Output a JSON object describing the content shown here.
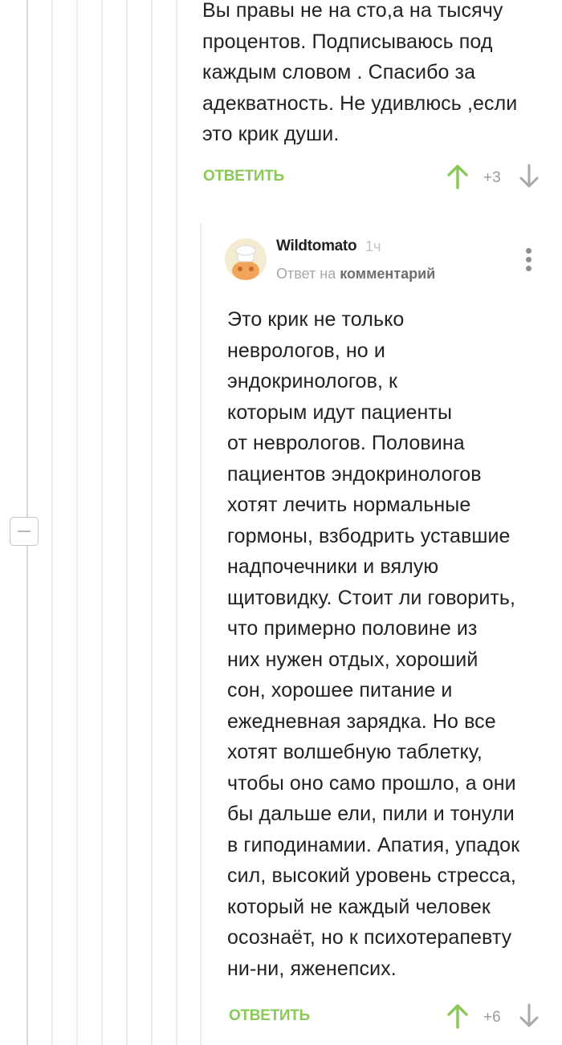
{
  "comment_parent": {
    "text": "Вы правы не на сто,а на тысячу\nпроцентов. Подписываюсь под\nкаждым словом . Спасибо за\nадекватность. Не удивлюсь ,если\nэто крик души.",
    "reply_label": "ОТВЕТИТЬ",
    "score": "+3"
  },
  "comment_reply": {
    "username": "Wildtomato",
    "time": "1ч",
    "reply_to_prefix": "Ответ на",
    "reply_to_link": "комментарий",
    "text": "Это крик не только\nневрологов, но и\nэндокринологов, к\nкоторым идут пациенты\nот неврологов. Половина\nпациентов эндокринологов\nхотят лечить нормальные\nгормоны, взбодрить уставшие\nнадпочечники и вялую\nщитовидку. Стоит ли говорить,\nчто примерно половине из\nних нужен отдых, хороший\nсон, хорошее питание и\nежедневная зарядка. Но все\nхотят волшебную таблетку,\nчтобы оно само прошло, а они\nбы дальше ели, пили и тонули\nв гиподинамии. Апатия, упадок\nсил, высокий уровень стресса,\nкоторый не каждый человек\nосознаёт, но к психотерапевту\nни-ни, яженепсих.",
    "reply_label": "ОТВЕТИТЬ",
    "score": "+6"
  },
  "colors": {
    "accent_green": "#8ac858",
    "vote_down_gray": "#a8a8a8",
    "thread_line": "#ececec"
  },
  "icons": {
    "upvote": "arrow-up-icon",
    "downvote": "arrow-down-icon",
    "more": "vertical-dots-icon",
    "collapse": "minus-icon"
  }
}
